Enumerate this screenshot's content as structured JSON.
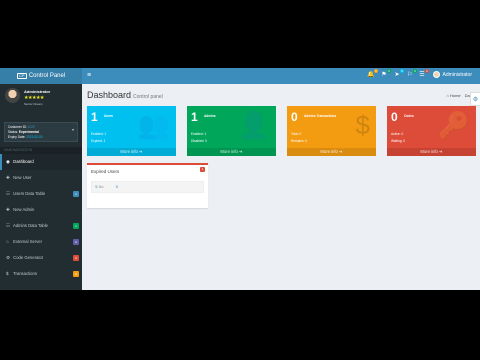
{
  "app": {
    "logo_text": "Control Panel",
    "logo_box": "CP"
  },
  "navbar": {
    "toggle": "≡",
    "icons": [
      {
        "name": "bell-icon",
        "glyph": "🔔",
        "badge": "0",
        "badge_color": "#f39c12"
      },
      {
        "name": "flag-icon",
        "glyph": "⚑",
        "badge": "0",
        "badge_color": "#00a65a"
      },
      {
        "name": "send-icon",
        "glyph": "➤",
        "badge": "0",
        "badge_color": "#00c0ef"
      },
      {
        "name": "bookmark-icon",
        "glyph": "⚐",
        "badge": "0",
        "badge_color": "#00a65a"
      },
      {
        "name": "tasks-icon",
        "glyph": "☰",
        "badge": "0",
        "badge_color": "#dd4b39"
      }
    ],
    "user_name": "Administrator"
  },
  "sidebar": {
    "user": {
      "name": "Administrator",
      "stars": "★★★★★",
      "role": "Senior Dream"
    },
    "customer": {
      "id_label": "Customer ID:",
      "id_value": "1029",
      "status_label": "Status:",
      "status_value": "Experimental",
      "expiry_label": "Expiry Date:",
      "expiry_value": "2023-00-00"
    },
    "nav_header": "MAIN NAVIGATION",
    "items": [
      {
        "label": "Dashboard",
        "icon": "◉",
        "badge": "",
        "badge_color": ""
      },
      {
        "label": "New User",
        "icon": "✚",
        "badge": "",
        "badge_color": ""
      },
      {
        "label": "Users Data Table",
        "icon": "☷",
        "badge": "1",
        "badge_color": "#3c8dbc"
      },
      {
        "label": "New Admin",
        "icon": "✚",
        "badge": "",
        "badge_color": ""
      },
      {
        "label": "Admins Data Table",
        "icon": "☷",
        "badge": "1",
        "badge_color": "#00a65a"
      },
      {
        "label": "External Server",
        "icon": "⌂",
        "badge": "0",
        "badge_color": "#605ca8"
      },
      {
        "label": "Code Generator",
        "icon": "⚙",
        "badge": "0",
        "badge_color": "#dd4b39"
      },
      {
        "label": "Transactions",
        "icon": "$",
        "badge": "0",
        "badge_color": "#f39c12"
      }
    ]
  },
  "main": {
    "title": "Dashboard",
    "subtitle": "Control panel",
    "breadcrumb_home": "Home",
    "breadcrumb_current": "Dash",
    "boxes": [
      {
        "count": "1",
        "label": "Users",
        "line1": "Enabled: 1",
        "line2": "Expired: 1",
        "footer": "More info ➔",
        "color": "#00c0ef",
        "icon": "👥"
      },
      {
        "count": "1",
        "label": "Admins",
        "line1": "Enabled: 1",
        "line2": "Disabled: 0",
        "footer": "More info ➔",
        "color": "#00a65a",
        "icon": "👤"
      },
      {
        "count": "0",
        "label": "Admins Transactions",
        "line1": "Total: 0",
        "line2": "Remains: 0",
        "footer": "More info ➔",
        "color": "#f39c12",
        "icon": "$"
      },
      {
        "count": "0",
        "label": "Codes",
        "line1": "Active: 0",
        "line2": "Waiting: 0",
        "footer": "More info ➔",
        "color": "#dd4b39",
        "icon": "🔑"
      }
    ],
    "expired": {
      "title": "Expired Users",
      "badge": "1",
      "col_no": "No"
    }
  }
}
